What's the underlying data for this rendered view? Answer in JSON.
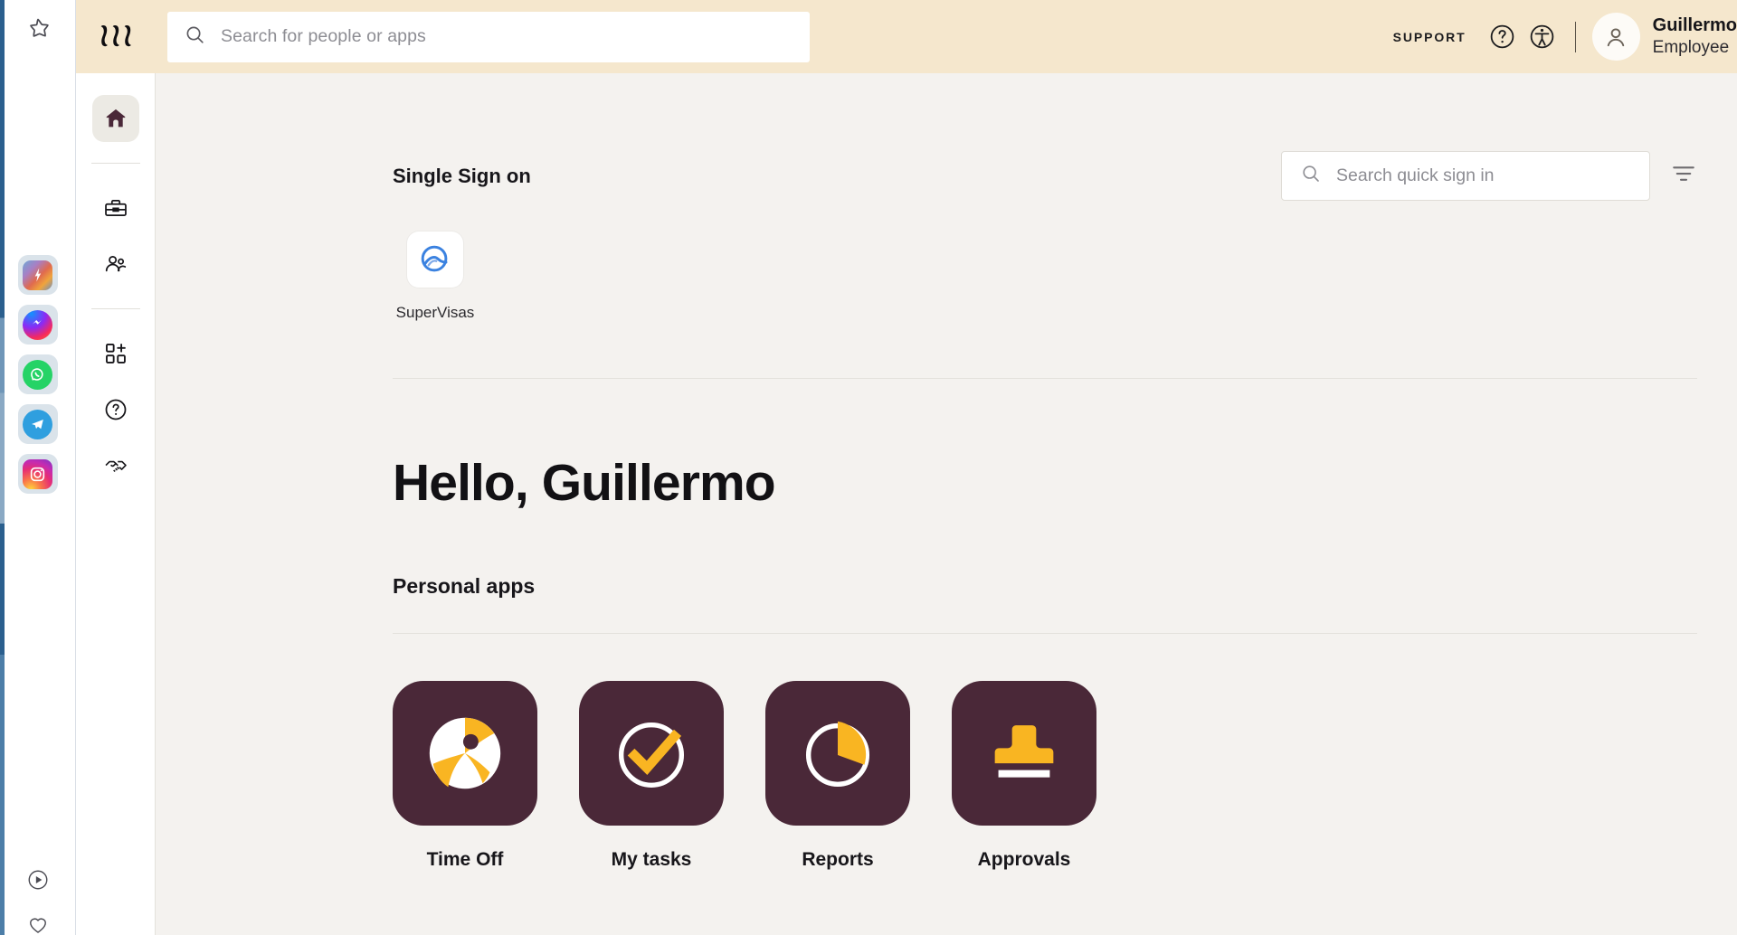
{
  "browser": {
    "star_icon": "star-outline-icon",
    "apps": [
      {
        "name": "gradient-app-icon",
        "label": "Pinned app"
      },
      {
        "name": "messenger-icon",
        "label": "Messenger"
      },
      {
        "name": "whatsapp-icon",
        "label": "WhatsApp"
      },
      {
        "name": "telegram-icon",
        "label": "Telegram"
      },
      {
        "name": "instagram-icon",
        "label": "Instagram"
      }
    ],
    "bottom_icons": [
      {
        "name": "play-circle-icon"
      },
      {
        "name": "heart-icon"
      }
    ]
  },
  "topbar": {
    "logo": "rippling-logo",
    "search": {
      "placeholder": "Search for people or apps",
      "value": "",
      "icon": "search-icon"
    },
    "support_label": "SUPPORT",
    "help_icon": "question-circle-icon",
    "accessibility_icon": "accessibility-icon",
    "avatar_icon": "user-avatar-icon",
    "user_name": "Guillermo",
    "user_role": "Employee",
    "background_color": "#f5e7cd"
  },
  "sidenav": {
    "items": [
      {
        "name": "sidebar-item-home",
        "icon": "home-icon",
        "active": true
      },
      {
        "name": "sidebar-item-toolbox",
        "icon": "toolbox-icon",
        "active": false
      },
      {
        "name": "sidebar-item-people",
        "icon": "people-icon",
        "active": false
      },
      {
        "name": "sidebar-item-add-app",
        "icon": "apps-grid-plus-icon",
        "active": false
      },
      {
        "name": "sidebar-item-help",
        "icon": "question-circle-icon",
        "active": false
      },
      {
        "name": "sidebar-item-partners",
        "icon": "handshake-icon",
        "active": false
      }
    ]
  },
  "main": {
    "sso": {
      "title": "Single Sign on",
      "search": {
        "placeholder": "Search quick sign in",
        "value": "",
        "icon": "search-icon"
      },
      "filter_icon": "filter-icon",
      "apps": [
        {
          "label": "SuperVisas",
          "icon": "supervisas-logo"
        }
      ]
    },
    "greeting": "Hello, Guillermo",
    "personal_apps": {
      "title": "Personal apps",
      "apps": [
        {
          "label": "Time Off",
          "icon": "beach-ball-icon"
        },
        {
          "label": "My tasks",
          "icon": "check-circle-icon"
        },
        {
          "label": "Reports",
          "icon": "pie-chart-icon"
        },
        {
          "label": "Approvals",
          "icon": "stamp-icon"
        }
      ]
    },
    "colors": {
      "background": "#f4f2ef",
      "tile": "#4a2838",
      "accent": "#f9b522"
    }
  }
}
